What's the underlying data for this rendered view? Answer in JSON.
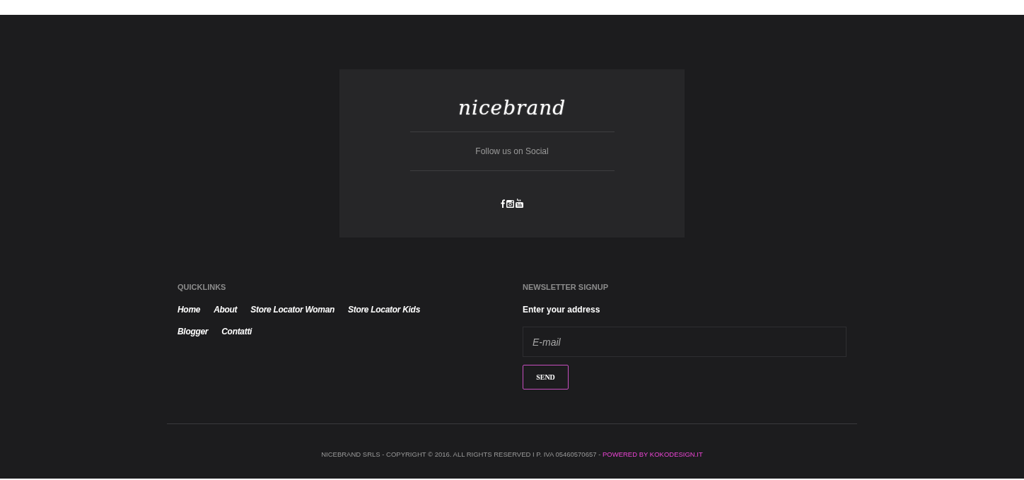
{
  "brand": {
    "logo": "nicebrand",
    "tagline": "Follow us on Social",
    "social": [
      {
        "kind": "facebook"
      },
      {
        "kind": "instagram"
      },
      {
        "kind": "youtube"
      }
    ]
  },
  "quicklinks": {
    "title": "QUICKLINKS",
    "links": [
      "Home",
      "About",
      "Store Locator Woman",
      "Store Locator Kids",
      "Blogger",
      "Contatti"
    ]
  },
  "newsletter": {
    "title": "NEWSLETTER SIGNUP",
    "label": "Enter your address",
    "placeholder": "E-mail",
    "button": "SEND"
  },
  "footer": {
    "copyright": "NICEBRAND SRLS - COPYRIGHT © 2016. ALL RIGHTS RESERVED I P. IVA 05460570657 - ",
    "link": "POWERED BY KOKODESIGN.IT"
  }
}
